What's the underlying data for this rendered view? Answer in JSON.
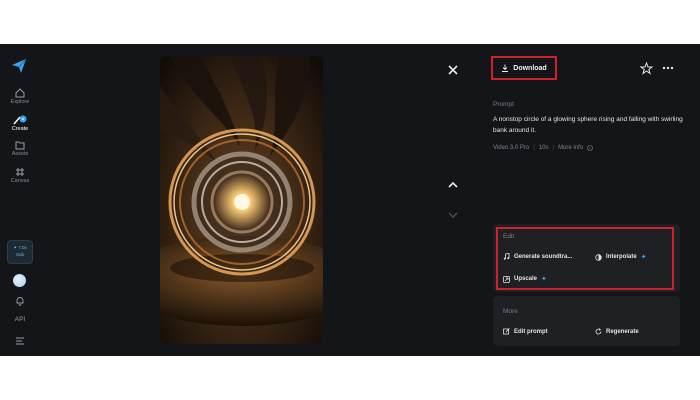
{
  "sidebar": {
    "items": [
      {
        "label": "Explore"
      },
      {
        "label": "Create"
      },
      {
        "label": "Assets"
      },
      {
        "label": "Canvas"
      }
    ],
    "upgrade_line1": "✦ 7.0x",
    "upgrade_line2": "Sub",
    "api_label": "API"
  },
  "toolbar": {
    "download_label": "Download"
  },
  "prompt": {
    "section_label": "Prompt",
    "text": "A nonstop circle of a glowing sphere rising and falling with swirling bank around it.",
    "model": "Video 3.0 Pro",
    "duration": "10s",
    "more_info": "More info"
  },
  "edit": {
    "section_label": "Edit",
    "generate_soundtrack": "Generate soundtra...",
    "interpolate": "Interpolate",
    "upscale": "Upscale"
  },
  "more": {
    "section_label": "More",
    "edit_prompt": "Edit prompt",
    "regenerate": "Regenerate"
  },
  "colors": {
    "accent": "#38a7f2",
    "highlight": "#d0202a",
    "background": "#141518"
  }
}
